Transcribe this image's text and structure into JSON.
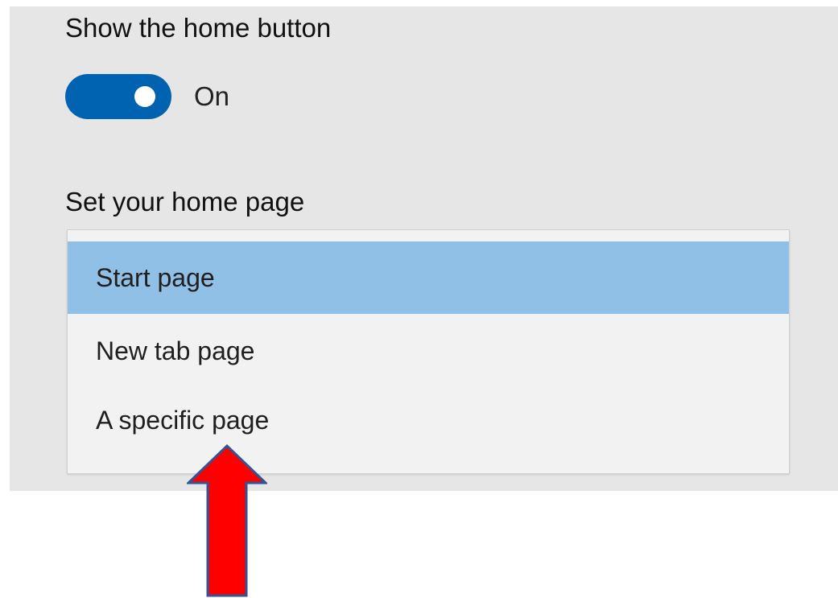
{
  "settings": {
    "show_home_button": {
      "title": "Show the home button",
      "toggle_state": "On",
      "toggle_on": true
    },
    "home_page": {
      "title": "Set your home page",
      "options": [
        "Start page",
        "New tab page",
        "A specific page"
      ],
      "selected_option": "Start page"
    }
  },
  "annotation": {
    "arrow_icon": "up-arrow-icon",
    "arrow_fill": "#ff0000",
    "arrow_stroke": "#2f5597"
  },
  "colors": {
    "panel_bg": "#e6e6e6",
    "toggle_on": "#0063b1",
    "selected_option_bg": "#91c0e6",
    "listbox_bg": "#f2f2f2"
  }
}
